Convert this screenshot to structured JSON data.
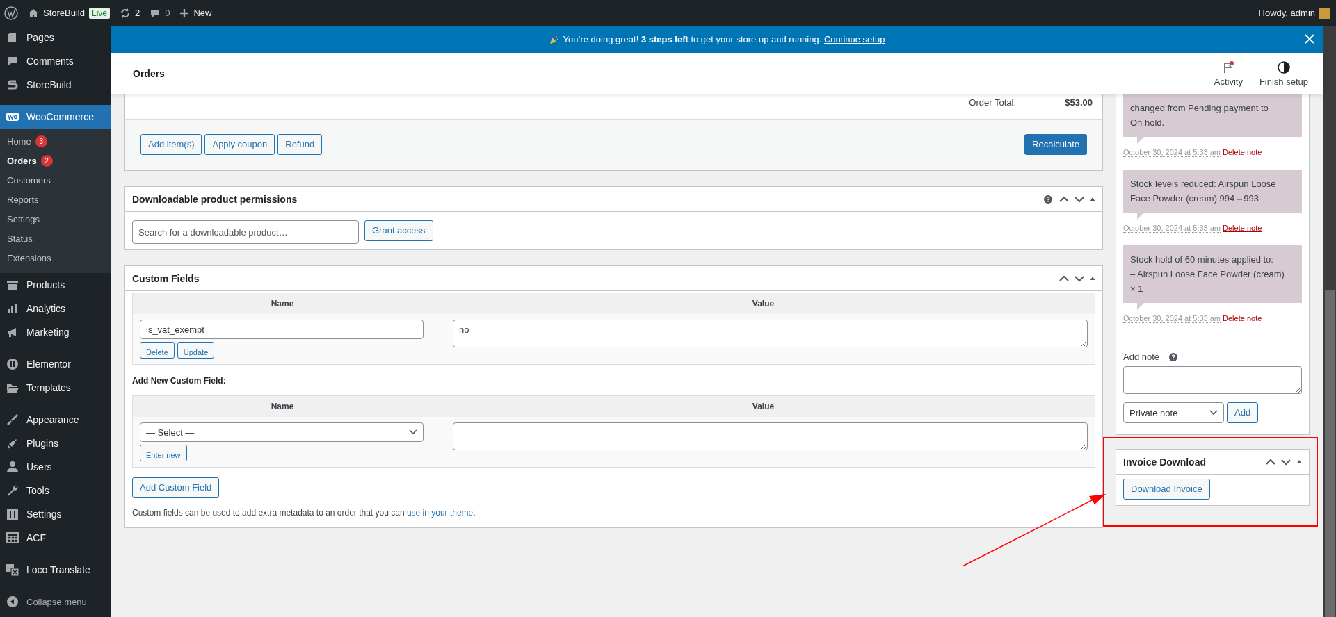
{
  "admin_bar": {
    "site": "StoreBuild",
    "badge": "Live",
    "updates": "2",
    "comments": "0",
    "new": "New",
    "greeting": "Howdy, admin"
  },
  "sidebar": {
    "groups": [
      {
        "items": [
          {
            "label": "Pages",
            "kind": "pages",
            "selected": false
          },
          {
            "label": "Comments",
            "kind": "comments",
            "selected": false
          },
          {
            "label": "StoreBuild",
            "kind": "storebuild",
            "selected": false
          }
        ]
      },
      {
        "items": [
          {
            "label": "WooCommerce",
            "kind": "woo",
            "selected": true,
            "children": [
              {
                "label": "Home",
                "count": "3",
                "selected": false
              },
              {
                "label": "Orders",
                "count": "2",
                "selected": true
              },
              {
                "label": "Customers",
                "selected": false
              },
              {
                "label": "Reports",
                "selected": false
              },
              {
                "label": "Settings",
                "selected": false
              },
              {
                "label": "Status",
                "selected": false
              },
              {
                "label": "Extensions",
                "selected": false
              }
            ]
          },
          {
            "label": "Products",
            "kind": "products",
            "selected": false
          },
          {
            "label": "Analytics",
            "kind": "analytics",
            "selected": false
          },
          {
            "label": "Marketing",
            "kind": "marketing",
            "selected": false
          }
        ]
      },
      {
        "items": [
          {
            "label": "Elementor",
            "kind": "elementor",
            "selected": false
          },
          {
            "label": "Templates",
            "kind": "folder",
            "selected": false
          }
        ]
      },
      {
        "items": [
          {
            "label": "Appearance",
            "kind": "brush",
            "selected": false
          },
          {
            "label": "Plugins",
            "kind": "plug",
            "selected": false
          },
          {
            "label": "Users",
            "kind": "user",
            "selected": false
          },
          {
            "label": "Tools",
            "kind": "wrench",
            "selected": false
          },
          {
            "label": "Settings",
            "kind": "sliders",
            "selected": false
          },
          {
            "label": "ACF",
            "kind": "table",
            "selected": false
          }
        ]
      },
      {
        "items": [
          {
            "label": "Loco Translate",
            "kind": "translate",
            "selected": false
          }
        ]
      }
    ],
    "collapse": "Collapse menu"
  },
  "banner": {
    "text": "You’re doing great! **3 steps left** to get your store up and running.",
    "link": "Continue setup"
  },
  "header": {
    "title": "Orders",
    "actions": [
      {
        "label": "Activity",
        "kind": "activity"
      },
      {
        "label": "Finish setup",
        "kind": "setup"
      }
    ]
  },
  "order_items": {
    "total_label": "Order Total:",
    "total": "$53.00",
    "buttons": [
      "Add item(s)",
      "Apply coupon",
      "Refund"
    ],
    "primary_button": "Recalculate"
  },
  "downloads": {
    "title": "Downloadable product permissions",
    "search": {
      "placeholder": "Search for a downloadable product…"
    },
    "button": "Grant access"
  },
  "custom_fields": {
    "title": "Custom Fields",
    "columns": [
      "Name",
      "Value"
    ],
    "rows": [
      {
        "name": "is_vat_exempt",
        "value": "no",
        "buttons": [
          "Delete",
          "Update"
        ]
      }
    ],
    "add_heading": "Add New Custom Field:",
    "add_columns": [
      "Name",
      "Value"
    ],
    "select": "— Select —",
    "enter_new": "Enter new",
    "add_button": "Add Custom Field",
    "help": "Custom fields can be used to add extra metadata to an order that you can ",
    "help_link": "use in your theme",
    "help_end": "."
  },
  "notes": [
    {
      "text": "changed from Pending payment to\nOn hold.",
      "date": "October 30, 2024 at 5:33 am",
      "delete": "Delete note"
    },
    {
      "text": "Stock levels reduced: Airspun Loose\nFace Powder (cream) 994→993",
      "date": "October 30, 2024 at 5:33 am",
      "delete": "Delete note"
    },
    {
      "text": "Stock hold of 60 minutes applied to:\n– Airspun Loose Face Powder (cream)\n× 1",
      "date": "October 30, 2024 at 5:33 am",
      "delete": "Delete note"
    }
  ],
  "add_note": {
    "label": "Add note",
    "note_type": "Private note",
    "button": "Add"
  },
  "invoice": {
    "title": "Invoice Download",
    "button": "Download Invoice"
  },
  "annotation": {
    "kind": "box-and-arrow"
  }
}
